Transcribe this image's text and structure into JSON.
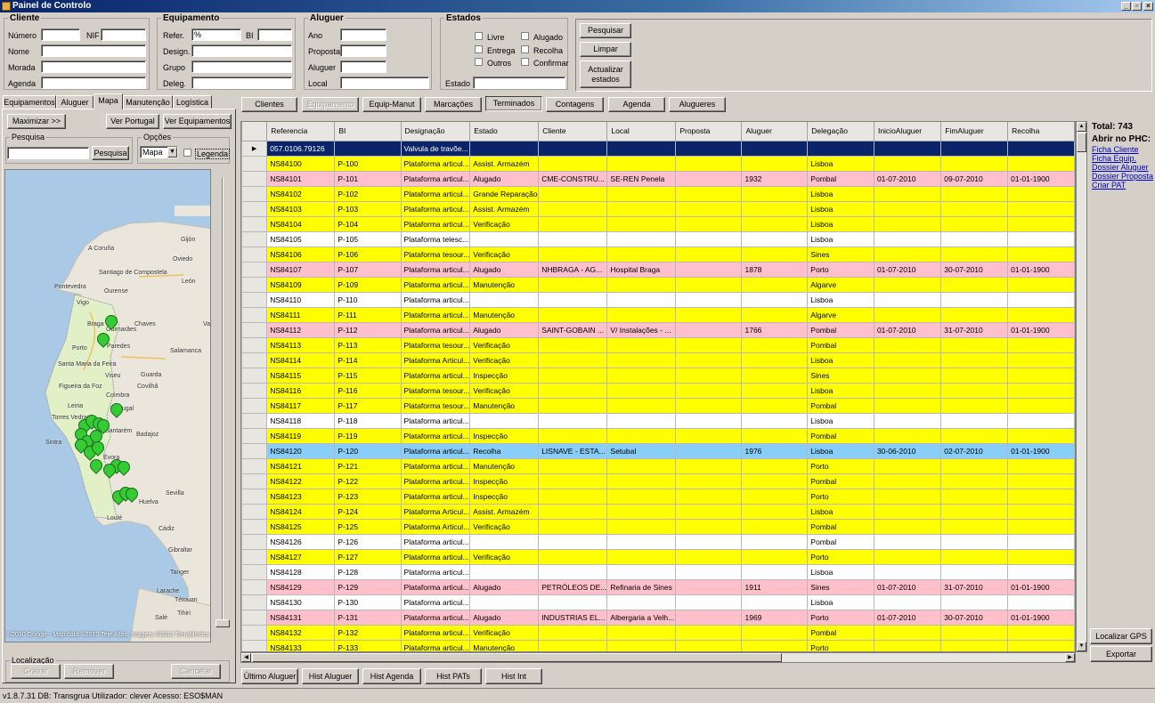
{
  "window": {
    "title": "Painel de Controlo"
  },
  "cliente": {
    "legend": "Cliente",
    "numero": "Número",
    "nif": "NIF",
    "nome": "Nome",
    "morada": "Morada",
    "agenda": "Agenda"
  },
  "equipamento": {
    "legend": "Equipamento",
    "refer": "Refer.",
    "refer_value": "%",
    "bi": "BI",
    "design": "Design.",
    "grupo": "Grupo",
    "deleg": "Deleg."
  },
  "aluguer": {
    "legend": "Aluguer",
    "ano": "Ano",
    "proposta": "Proposta",
    "aluguer": "Aluguer",
    "local": "Local"
  },
  "estados": {
    "legend": "Estados",
    "livre": "Livre",
    "alugado": "Alugado",
    "entrega": "Entrega",
    "recolha": "Recolha",
    "outros": "Outros",
    "confirmar": "Confirmar",
    "estado": "Estado"
  },
  "actions": {
    "pesquisar": "Pesquisar",
    "limpar": "Limpar",
    "actualizar": "Actualizar estados"
  },
  "left_tabs": [
    "Equipamentos",
    "Aluguer",
    "Mapa",
    "Manutenção",
    "Logística"
  ],
  "left": {
    "maximizar": "Maximizar >>",
    "ver_portugal": "Ver Portugal",
    "ver_equipamentos": "Ver Equipamentos",
    "pesquisa_legend": "Pesquisa",
    "pesquisa_btn": "Pesquisa",
    "opcoes_legend": "Opções",
    "mapa_select": "Mapa",
    "legenda": "Legenda"
  },
  "map": {
    "attribution": "©2010 Google - Map data ©2010 Tele Atlas, Imagery ©2010 TerraMetrics",
    "places": [
      "A Coruña",
      "Gijón",
      "Oviedo",
      "Santiago de Compostela",
      "León",
      "Pontevedra",
      "Ourense",
      "Vigo",
      "Chaves",
      "Braga",
      "Guimarães",
      "Porto",
      "Paredes",
      "Salamanca",
      "Santa Maria da Feira",
      "Viseu",
      "Guarda",
      "Figueira da Foz",
      "Covilhã",
      "Coimbra",
      "Leiria",
      "Portugal",
      "Torres Vedras",
      "Santarém",
      "Sintra",
      "Badajoz",
      "Évora",
      "Sevilla",
      "Huelva",
      "Loulé",
      "Cádiz",
      "Gibraltar",
      "Tanger",
      "Larache",
      "Tétouan",
      "Tihiri",
      "Salé",
      "Valladolid"
    ]
  },
  "localizacao": {
    "legend": "Localização",
    "gravar": "Gravar",
    "remover": "Remover",
    "cancelar": "Cancelar"
  },
  "top_tabs": [
    "Clientes",
    "Equipamento",
    "Equip-Manut",
    "Marcações",
    "Terminados",
    "Contagens",
    "Agenda",
    "Alugueres"
  ],
  "columns": [
    "Referencia",
    "BI",
    "Designação",
    "Estado",
    "Cliente",
    "Local",
    "Proposta",
    "Aluguer",
    "Delegação",
    "InicioAluguer",
    "FimAluguer",
    "Recolha"
  ],
  "rows": [
    {
      "c": "navy",
      "v": [
        "057.0106.79126",
        "",
        "Valvula de travõe...",
        "",
        "",
        "",
        "",
        "",
        "",
        "",
        "",
        ""
      ]
    },
    {
      "c": "yellow",
      "v": [
        "NS84100",
        "P-100",
        "Plataforma articul...",
        "Assist. Armazém",
        "",
        "",
        "",
        "",
        "Lisboa",
        "",
        "",
        ""
      ]
    },
    {
      "c": "pink",
      "v": [
        "NS84101",
        "P-101",
        "Plataforma articul...",
        "Alugado",
        "CME-CONSTRU...",
        "SE-REN Penela",
        "",
        "1932",
        "Pombal",
        "01-07-2010",
        "09-07-2010",
        "01-01-1900"
      ]
    },
    {
      "c": "yellow",
      "v": [
        "NS84102",
        "P-102",
        "Plataforma articul...",
        "Grande Reparação",
        "",
        "",
        "",
        "",
        "Lisboa",
        "",
        "",
        ""
      ]
    },
    {
      "c": "yellow",
      "v": [
        "NS84103",
        "P-103",
        "Plataforma articul...",
        "Assist. Armazém",
        "",
        "",
        "",
        "",
        "Lisboa",
        "",
        "",
        ""
      ]
    },
    {
      "c": "yellow",
      "v": [
        "NS84104",
        "P-104",
        "Plataforma articul...",
        "Verificação",
        "",
        "",
        "",
        "",
        "Lisboa",
        "",
        "",
        ""
      ]
    },
    {
      "c": "white",
      "v": [
        "NS84105",
        "P-105",
        "Plataforma telesc...",
        "",
        "",
        "",
        "",
        "",
        "Lisboa",
        "",
        "",
        ""
      ]
    },
    {
      "c": "yellow",
      "v": [
        "NS84106",
        "P-106",
        "Plataforma tesour...",
        "Verificação",
        "",
        "",
        "",
        "",
        "Sines",
        "",
        "",
        ""
      ]
    },
    {
      "c": "pink",
      "v": [
        "NS84107",
        "P-107",
        "Plataforma articul...",
        "Alugado",
        "NHBRAGA - AG...",
        "Hospital Braga",
        "",
        "1878",
        "Porto",
        "01-07-2010",
        "30-07-2010",
        "01-01-1900"
      ]
    },
    {
      "c": "yellow",
      "v": [
        "NS84109",
        "P-109",
        "Plataforma articul...",
        "Manutenção",
        "",
        "",
        "",
        "",
        "Algarve",
        "",
        "",
        ""
      ]
    },
    {
      "c": "white",
      "v": [
        "NS84110",
        "P-110",
        "Plataforma articul...",
        "",
        "",
        "",
        "",
        "",
        "Lisboa",
        "",
        "",
        ""
      ]
    },
    {
      "c": "yellow",
      "v": [
        "NS84111",
        "P-111",
        "Plataforma articul...",
        "Manutenção",
        "",
        "",
        "",
        "",
        "Algarve",
        "",
        "",
        ""
      ]
    },
    {
      "c": "pink",
      "v": [
        "NS84112",
        "P-112",
        "Plataforma articul...",
        "Alugado",
        "SAINT-GOBAIN ...",
        "V/ Instalações - ...",
        "",
        "1766",
        "Pombal",
        "01-07-2010",
        "31-07-2010",
        "01-01-1900"
      ]
    },
    {
      "c": "yellow",
      "v": [
        "NS84113",
        "P-113",
        "Plataforma tesour...",
        "Verificação",
        "",
        "",
        "",
        "",
        "Pombal",
        "",
        "",
        ""
      ]
    },
    {
      "c": "yellow",
      "v": [
        "NS84114",
        "P-114",
        "Plataforma Articul...",
        "Verificação",
        "",
        "",
        "",
        "",
        "Lisboa",
        "",
        "",
        ""
      ]
    },
    {
      "c": "yellow",
      "v": [
        "NS84115",
        "P-115",
        "Plataforma articul...",
        "Inspecção",
        "",
        "",
        "",
        "",
        "Sines",
        "",
        "",
        ""
      ]
    },
    {
      "c": "yellow",
      "v": [
        "NS84116",
        "P-116",
        "Plataforma tesour...",
        "Verificação",
        "",
        "",
        "",
        "",
        "Lisboa",
        "",
        "",
        ""
      ]
    },
    {
      "c": "yellow",
      "v": [
        "NS84117",
        "P-117",
        "Plataforma tesour...",
        "Manutenção",
        "",
        "",
        "",
        "",
        "Pombal",
        "",
        "",
        ""
      ]
    },
    {
      "c": "white",
      "v": [
        "NS84118",
        "P-118",
        "Plataforma articul...",
        "",
        "",
        "",
        "",
        "",
        "Lisboa",
        "",
        "",
        ""
      ]
    },
    {
      "c": "yellow",
      "v": [
        "NS84119",
        "P-119",
        "Plataforma articul...",
        "Inspecção",
        "",
        "",
        "",
        "",
        "Pombal",
        "",
        "",
        ""
      ]
    },
    {
      "c": "blue",
      "v": [
        "NS84120",
        "P-120",
        "Plataforma articul...",
        "Recolha",
        "LISNAVE - ESTA...",
        "Setubal",
        "",
        "1976",
        "Lisboa",
        "30-06-2010",
        "02-07-2010",
        "01-01-1900"
      ]
    },
    {
      "c": "yellow",
      "v": [
        "NS84121",
        "P-121",
        "Plataforma articul...",
        "Manutenção",
        "",
        "",
        "",
        "",
        "Porto",
        "",
        "",
        ""
      ]
    },
    {
      "c": "yellow",
      "v": [
        "NS84122",
        "P-122",
        "Plataforma articul...",
        "Inspecção",
        "",
        "",
        "",
        "",
        "Pombal",
        "",
        "",
        ""
      ]
    },
    {
      "c": "yellow",
      "v": [
        "NS84123",
        "P-123",
        "Plataforma articul...",
        "Inspecção",
        "",
        "",
        "",
        "",
        "Porto",
        "",
        "",
        ""
      ]
    },
    {
      "c": "yellow",
      "v": [
        "NS84124",
        "P-124",
        "Plataforma Articul...",
        "Assist. Armazém",
        "",
        "",
        "",
        "",
        "Lisboa",
        "",
        "",
        ""
      ]
    },
    {
      "c": "yellow",
      "v": [
        "NS84125",
        "P-125",
        "Plataforma Articul...",
        "Verificação",
        "",
        "",
        "",
        "",
        "Pombal",
        "",
        "",
        ""
      ]
    },
    {
      "c": "white",
      "v": [
        "NS84126",
        "P-126",
        "Plataforma articul...",
        "",
        "",
        "",
        "",
        "",
        "Pombal",
        "",
        "",
        ""
      ]
    },
    {
      "c": "yellow",
      "v": [
        "NS84127",
        "P-127",
        "Plataforma articul...",
        "Verificação",
        "",
        "",
        "",
        "",
        "Porto",
        "",
        "",
        ""
      ]
    },
    {
      "c": "white",
      "v": [
        "NS84128",
        "P-128",
        "Plataforma articul...",
        "",
        "",
        "",
        "",
        "",
        "Lisboa",
        "",
        "",
        ""
      ]
    },
    {
      "c": "pink",
      "v": [
        "NS84129",
        "P-129",
        "Plataforma articul...",
        "Alugado",
        "PETRÓLEOS DE...",
        "Refinaria de Sines",
        "",
        "1911",
        "Sines",
        "01-07-2010",
        "31-07-2010",
        "01-01-1900"
      ]
    },
    {
      "c": "white",
      "v": [
        "NS84130",
        "P-130",
        "Plataforma articul...",
        "",
        "",
        "",
        "",
        "",
        "Lisboa",
        "",
        "",
        ""
      ]
    },
    {
      "c": "pink",
      "v": [
        "NS84131",
        "P-131",
        "Plataforma articul...",
        "Alugado",
        "INDUSTRIAS EL...",
        "Albergaria a Velh...",
        "",
        "1969",
        "Porto",
        "01-07-2010",
        "30-07-2010",
        "01-01-1900"
      ]
    },
    {
      "c": "yellow",
      "v": [
        "NS84132",
        "P-132",
        "Plataforma articul...",
        "Verificação",
        "",
        "",
        "",
        "",
        "Pombal",
        "",
        "",
        ""
      ]
    },
    {
      "c": "yellow",
      "v": [
        "NS84133",
        "P-133",
        "Plataforma articul...",
        "Manutenção",
        "",
        "",
        "",
        "",
        "Porto",
        "",
        "",
        ""
      ]
    }
  ],
  "right": {
    "total": "Total: 743",
    "abrir": "Abrir no PHC:",
    "links": [
      "Ficha Cliente",
      "Ficha Equip.",
      "Dossier Aluguer",
      "Dossier Proposta",
      "Criar PAT"
    ],
    "localizar_gps": "Localizar GPS",
    "exportar": "Exportar"
  },
  "bottom_tabs": [
    "Último Aluguer",
    "Hist Aluguer",
    "Hist Agenda",
    "Hist PATs",
    "Hist Int"
  ],
  "status": "v1.8.7.31  DB: Transgrua  Utilizador: clever   Acesso: ESO$MAN",
  "colors": {
    "yellow": "#ffff00",
    "pink": "#ffc0cb",
    "blue": "#87cefa",
    "navy": "#0a246a",
    "marker": "#33cc33"
  }
}
